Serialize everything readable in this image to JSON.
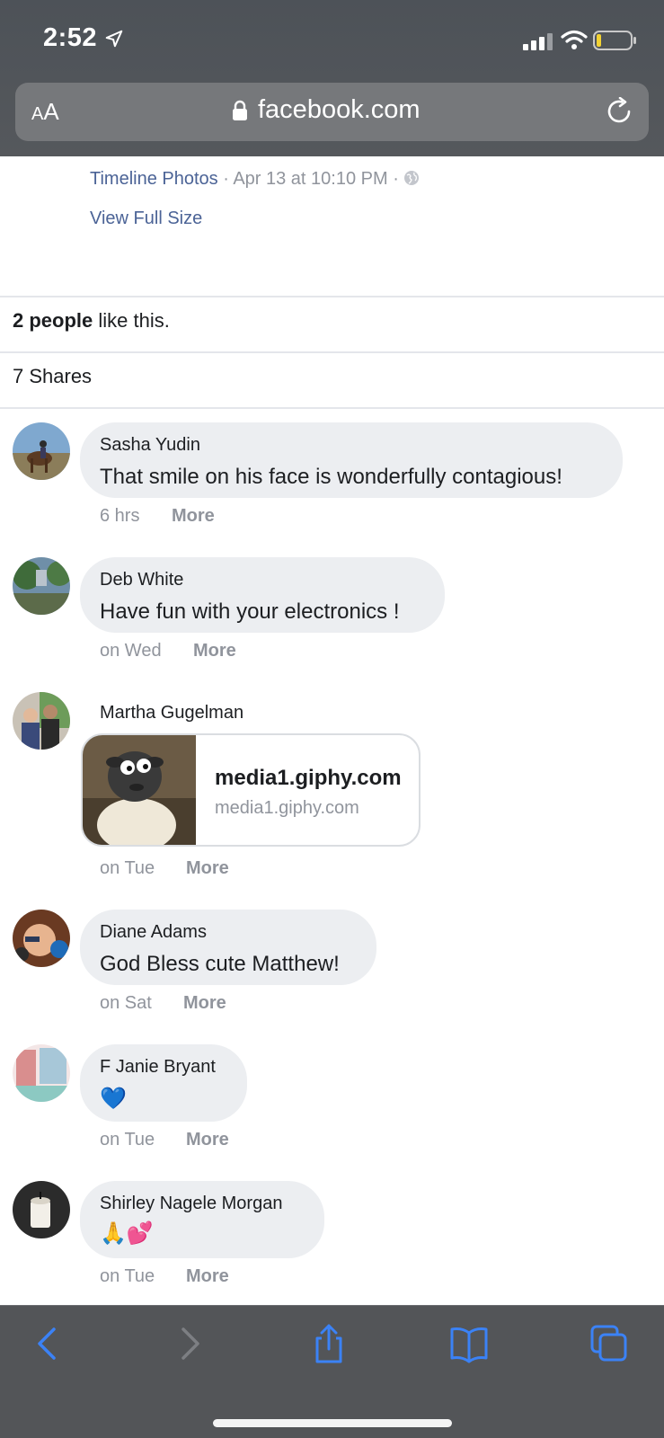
{
  "status_bar": {
    "time": "2:52"
  },
  "browser": {
    "text_size_label_small": "A",
    "text_size_label_large": "A",
    "url": "facebook.com"
  },
  "post_meta": {
    "album": "Timeline Photos",
    "separator": " · ",
    "date": "Apr 13 at 10:10 PM",
    "separator2": " · ",
    "view_full_size": "View Full Size"
  },
  "likes": {
    "count_text": "2 people",
    "suffix": " like this."
  },
  "shares": {
    "text": "7 Shares"
  },
  "comments": [
    {
      "author": "Sasha Yudin",
      "text": "That smile on his face is wonderfully contagious!",
      "time": "6 hrs",
      "more": "More"
    },
    {
      "author": "Deb White",
      "text": "Have fun with your electronics !",
      "time": "on Wed",
      "more": "More"
    },
    {
      "author": "Martha Gugelman",
      "link_title": "media1.giphy.com",
      "link_domain": "media1.giphy.com",
      "time": "on Tue",
      "more": "More"
    },
    {
      "author": "Diane Adams",
      "text": "God Bless cute Matthew!",
      "time": "on Sat",
      "more": "More"
    },
    {
      "author": "F Janie Bryant",
      "text": "💙",
      "time": "on Tue",
      "more": "More"
    },
    {
      "author": "Shirley Nagele Morgan",
      "text": "🙏💕",
      "time": "on Tue",
      "more": "More"
    }
  ],
  "toolbar": {
    "icons": [
      "back-icon",
      "forward-icon",
      "share-icon",
      "bookmarks-icon",
      "tabs-icon"
    ]
  },
  "colors": {
    "link_blue": "#4b6396",
    "meta_gray": "#90949c",
    "bubble_bg": "#eceef1",
    "ios_blue": "#3b82f6"
  }
}
